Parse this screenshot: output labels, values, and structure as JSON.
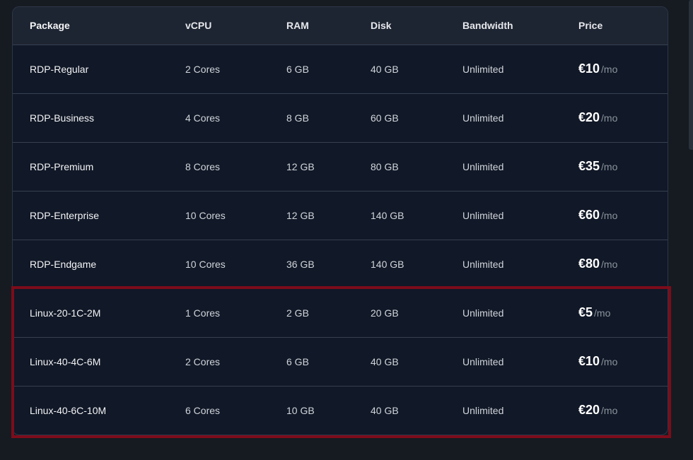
{
  "table": {
    "headers": [
      "Package",
      "vCPU",
      "RAM",
      "Disk",
      "Bandwidth",
      "Price"
    ],
    "price_suffix": "/mo",
    "rows": [
      {
        "package": "RDP-Regular",
        "vcpu": "2 Cores",
        "ram": "6 GB",
        "disk": "40 GB",
        "bandwidth": "Unlimited",
        "price": "€10"
      },
      {
        "package": "RDP-Business",
        "vcpu": "4 Cores",
        "ram": "8 GB",
        "disk": "60 GB",
        "bandwidth": "Unlimited",
        "price": "€20"
      },
      {
        "package": "RDP-Premium",
        "vcpu": "8 Cores",
        "ram": "12 GB",
        "disk": "80 GB",
        "bandwidth": "Unlimited",
        "price": "€35"
      },
      {
        "package": "RDP-Enterprise",
        "vcpu": "10 Cores",
        "ram": "12 GB",
        "disk": "140 GB",
        "bandwidth": "Unlimited",
        "price": "€60"
      },
      {
        "package": "RDP-Endgame",
        "vcpu": "10 Cores",
        "ram": "36 GB",
        "disk": "140 GB",
        "bandwidth": "Unlimited",
        "price": "€80"
      },
      {
        "package": "Linux-20-1C-2M",
        "vcpu": "1 Cores",
        "ram": "2 GB",
        "disk": "20 GB",
        "bandwidth": "Unlimited",
        "price": "€5"
      },
      {
        "package": "Linux-40-4C-6M",
        "vcpu": "2 Cores",
        "ram": "6 GB",
        "disk": "40 GB",
        "bandwidth": "Unlimited",
        "price": "€10"
      },
      {
        "package": "Linux-40-6C-10M",
        "vcpu": "6 Cores",
        "ram": "10 GB",
        "disk": "40 GB",
        "bandwidth": "Unlimited",
        "price": "€20"
      }
    ]
  },
  "colors": {
    "background": "#161b22",
    "table_background": "#111827",
    "header_background": "#1e2532",
    "highlight_border": "#7d0c1b"
  }
}
